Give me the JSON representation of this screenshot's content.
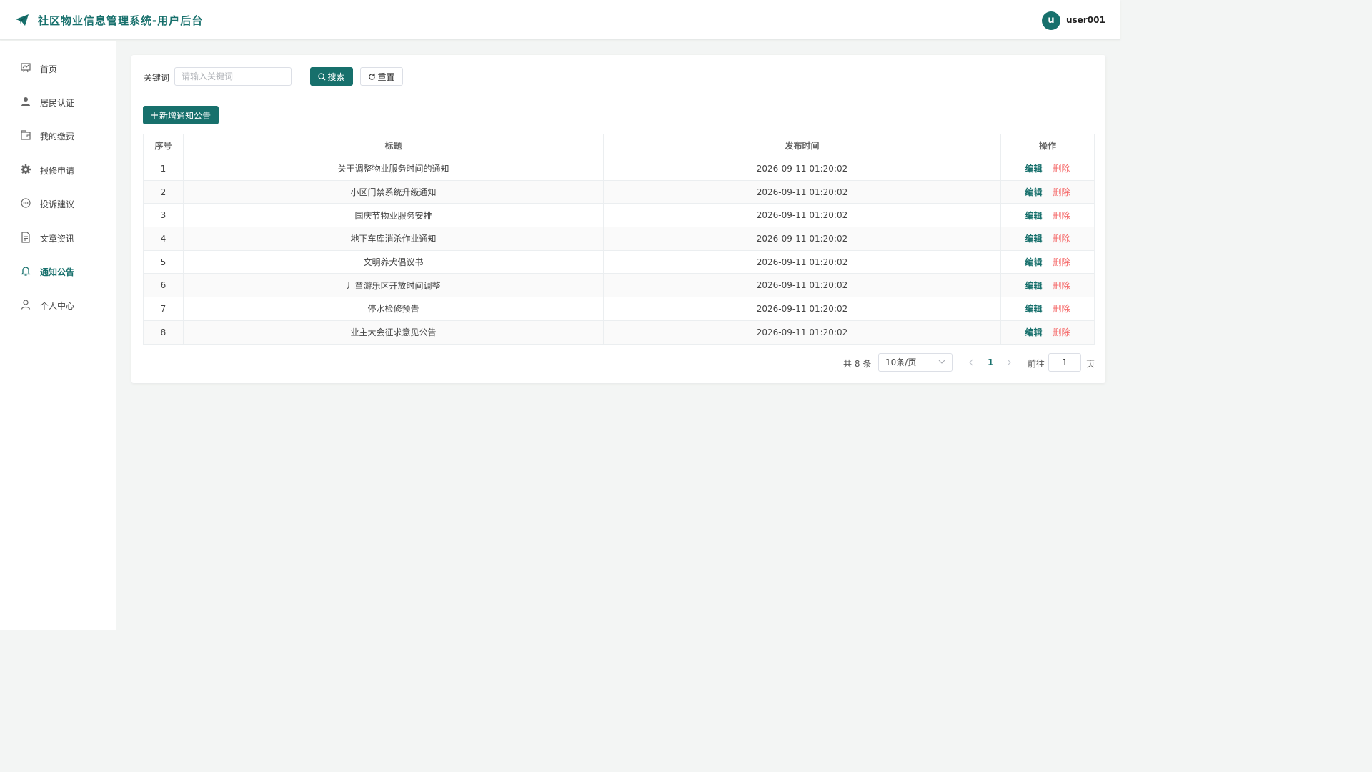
{
  "app": {
    "title": "社区物业信息管理系统-用户后台"
  },
  "user": {
    "avatar_letter": "u",
    "name": "user001"
  },
  "colors": {
    "brand": "#17706c",
    "danger": "#f56c6c",
    "bg": "#f3f5f4"
  },
  "sidebar": {
    "items": [
      {
        "label": "首页",
        "icon": "dashboard-icon",
        "active": false
      },
      {
        "label": "居民认证",
        "icon": "user-icon",
        "active": false
      },
      {
        "label": "我的缴费",
        "icon": "wallet-icon",
        "active": false
      },
      {
        "label": "报修申请",
        "icon": "gear-icon",
        "active": false
      },
      {
        "label": "投诉建议",
        "icon": "chat-icon",
        "active": false
      },
      {
        "label": "文章资讯",
        "icon": "document-icon",
        "active": false
      },
      {
        "label": "通知公告",
        "icon": "bell-icon",
        "active": true
      },
      {
        "label": "个人中心",
        "icon": "person-icon",
        "active": false
      }
    ]
  },
  "search": {
    "label": "关键词",
    "placeholder": "请输入关键词",
    "value": "",
    "search_button": "搜索",
    "reset_button": "重置"
  },
  "toolbar": {
    "add_button": "新增通知公告"
  },
  "table": {
    "columns": [
      "序号",
      "标题",
      "发布时间",
      "操作"
    ],
    "edit_label": "编辑",
    "delete_label": "删除",
    "rows": [
      {
        "index": "1",
        "title": "关于调整物业服务时间的通知",
        "time": "2026-09-11 01:20:02"
      },
      {
        "index": "2",
        "title": "小区门禁系统升级通知",
        "time": "2026-09-11 01:20:02"
      },
      {
        "index": "3",
        "title": "国庆节物业服务安排",
        "time": "2026-09-11 01:20:02"
      },
      {
        "index": "4",
        "title": "地下车库消杀作业通知",
        "time": "2026-09-11 01:20:02"
      },
      {
        "index": "5",
        "title": "文明养犬倡议书",
        "time": "2026-09-11 01:20:02"
      },
      {
        "index": "6",
        "title": "儿童游乐区开放时间调整",
        "time": "2026-09-11 01:20:02"
      },
      {
        "index": "7",
        "title": "停水检修预告",
        "time": "2026-09-11 01:20:02"
      },
      {
        "index": "8",
        "title": "业主大会征求意见公告",
        "time": "2026-09-11 01:20:02"
      }
    ]
  },
  "pagination": {
    "total_text": "共 8 条",
    "page_size": "10条/页",
    "current_page": "1",
    "goto_label": "前往",
    "goto_value": "1",
    "page_unit": "页"
  }
}
